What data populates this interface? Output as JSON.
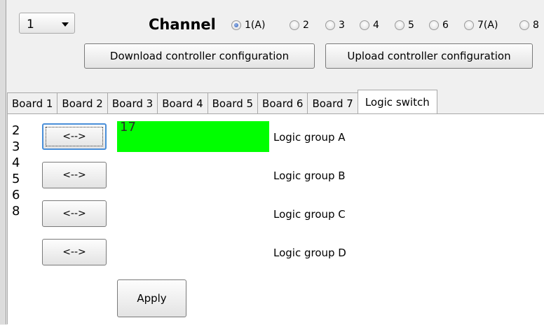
{
  "board_select": {
    "value": "1"
  },
  "channel": {
    "label": "Channel",
    "options": [
      {
        "label": "1(A)",
        "checked": true
      },
      {
        "label": "2",
        "checked": false
      },
      {
        "label": "3",
        "checked": false
      },
      {
        "label": "4",
        "checked": false
      },
      {
        "label": "5",
        "checked": false
      },
      {
        "label": "6",
        "checked": false
      },
      {
        "label": "7(A)",
        "checked": false
      },
      {
        "label": "8",
        "checked": false
      }
    ]
  },
  "buttons": {
    "download": "Download controller configuration",
    "upload": "Upload controller configuration",
    "apply": "Apply",
    "swap": "<-->"
  },
  "tabs": [
    "Board 1",
    "Board 2",
    "Board 3",
    "Board 4",
    "Board 5",
    "Board 6",
    "Board 7",
    "Logic switch"
  ],
  "active_tab": "Logic switch",
  "number_list": [
    "2",
    "3",
    "4",
    "5",
    "6",
    "8"
  ],
  "groups": [
    {
      "label": "Logic group A",
      "value": "17",
      "highlight_color": "#00ff00"
    },
    {
      "label": "Logic group B",
      "value": ""
    },
    {
      "label": "Logic group C",
      "value": ""
    },
    {
      "label": "Logic group D",
      "value": ""
    }
  ]
}
